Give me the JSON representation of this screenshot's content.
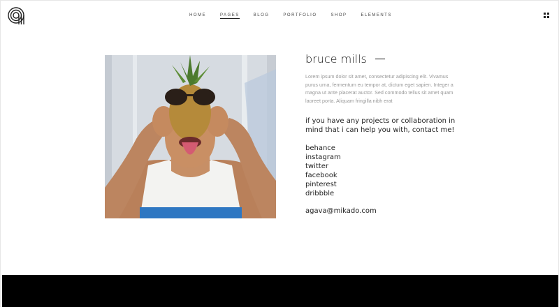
{
  "nav": {
    "items": [
      {
        "label": "HOME"
      },
      {
        "label": "PAGES"
      },
      {
        "label": "BLOG"
      },
      {
        "label": "PORTFOLIO"
      },
      {
        "label": "SHOP"
      },
      {
        "label": "ELEMENTS"
      }
    ],
    "active_index": 1
  },
  "profile": {
    "name": "bruce mills",
    "bio": "Lorem ipsum dolor sit amet, consectetur adipiscing elit. Vivamus purus urna, fermentum eu tempor at, dictum eget sapien. Integer a magna ut ante placerat auctor. Sed commodo tellus sit amet quam laoreet porta. Aliquam fringilla nibh erat",
    "contact_prompt": "if you have any projects or collaboration in mind that i can help you with, contact me!",
    "social_links": [
      "behance",
      "instagram",
      "twitter",
      "facebook",
      "pinterest",
      "dribbble"
    ],
    "email": "agava@mikado.com"
  },
  "icons": {
    "logo": "agava-logo-icon",
    "menu": "grid-menu-icon"
  },
  "colors": {
    "text": "#222222",
    "muted": "#999999",
    "footer": "#000000"
  }
}
